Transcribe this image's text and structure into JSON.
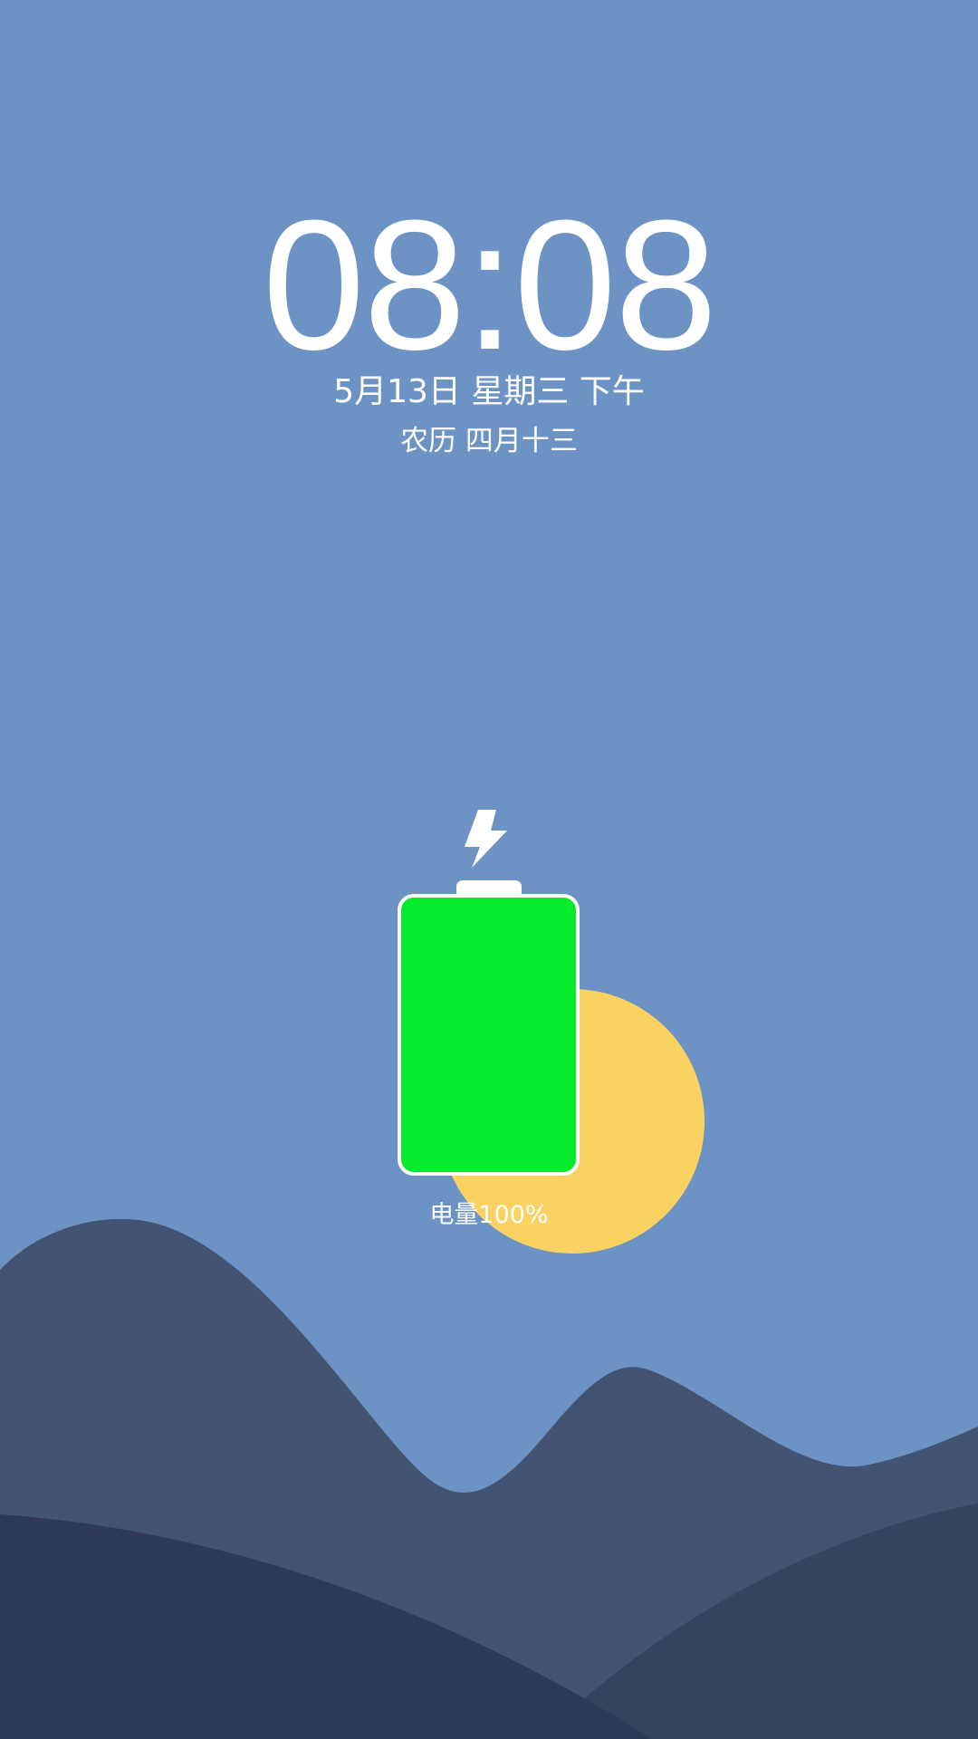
{
  "lockscreen": {
    "time": "08:08",
    "date": "5月13日  星期三  下午",
    "lunar_date": "农历 四月十三"
  },
  "charging": {
    "is_charging": true,
    "level_percent": 100,
    "label": "电量100%",
    "icon": "lightning-bolt-icon"
  },
  "colors": {
    "sky": "#6d93c4",
    "sun": "#f9d262",
    "battery_fill": "#05ea2a",
    "battery_outline": "#ffffff",
    "hill_back": "#425472",
    "hill_front_left": "#2e3a58",
    "hill_front_right": "#34445f",
    "text": "#ffffff"
  }
}
